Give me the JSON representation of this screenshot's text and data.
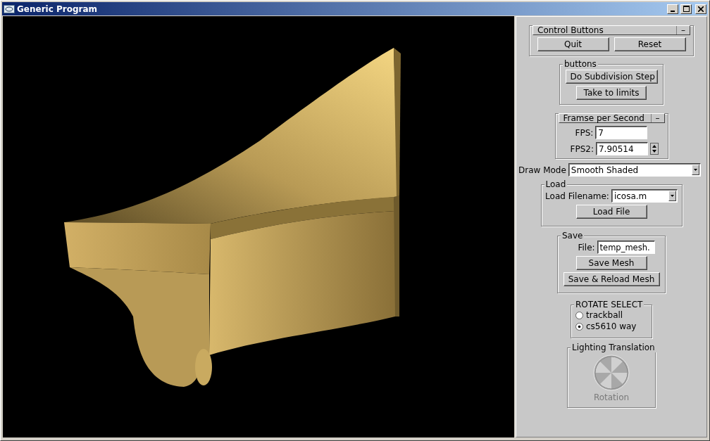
{
  "window": {
    "title": "Generic Program"
  },
  "control_buttons": {
    "title": "Control Buttons",
    "collapse": "–",
    "buttons": [
      "Quit",
      "Reset"
    ]
  },
  "buttons_group": {
    "title": "buttons",
    "buttons": [
      "Do Subdivision Step",
      "Take to limits"
    ]
  },
  "fps": {
    "title": "Framse per Second",
    "collapse": "–",
    "fields": [
      {
        "label": "FPS:",
        "value": "7",
        "kind": "text"
      },
      {
        "label": "FPS2:",
        "value": "7.90514",
        "kind": "spinner"
      }
    ]
  },
  "draw_mode": {
    "label": "Draw Mode",
    "value": "Smooth Shaded"
  },
  "load": {
    "title": "Load",
    "label": "Load Filename:",
    "value": "icosa.m",
    "button": "Load File"
  },
  "save": {
    "title": "Save",
    "label": "File:",
    "value": "temp_mesh.",
    "buttons": [
      "Save Mesh",
      "Save & Reload Mesh"
    ]
  },
  "rotate_select": {
    "title": "ROTATE SELECT",
    "options": [
      {
        "label": "trackball",
        "selected": false
      },
      {
        "label": "cs5610 way",
        "selected": true
      }
    ]
  },
  "lighting": {
    "title": "Lighting Translation",
    "control_label": "Rotation",
    "disabled": true
  }
}
